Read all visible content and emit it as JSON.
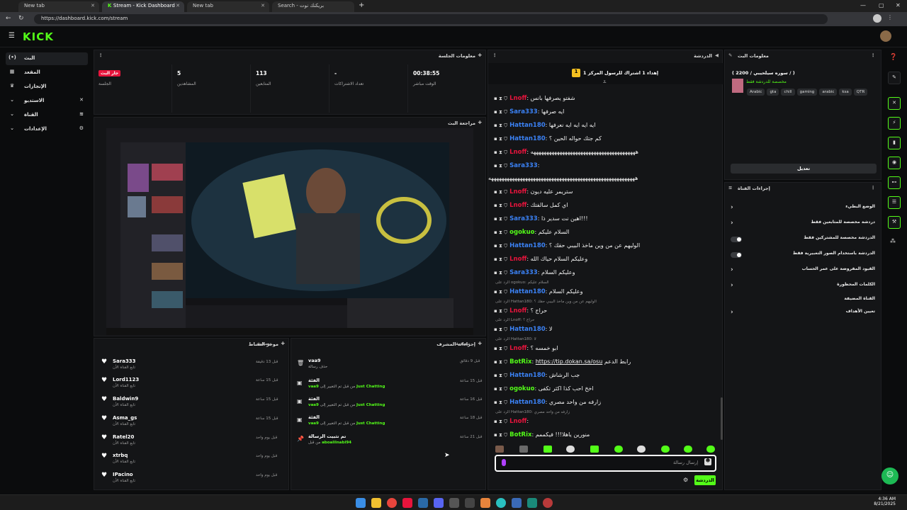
{
  "browser": {
    "tabs": [
      {
        "label": "New tab",
        "active": false
      },
      {
        "label": "Stream - Kick Dashboard",
        "active": true
      },
      {
        "label": "New tab",
        "active": false
      },
      {
        "label": "بريكنك نوت - Search",
        "active": false
      }
    ],
    "url": "https://dashboard.kick.com/stream"
  },
  "app": {
    "logo": "KICK"
  },
  "sidebar": {
    "items": [
      {
        "label": "البث",
        "icon": "(•)",
        "active": true
      },
      {
        "label": "المقعد",
        "icon": "▦",
        "active": false
      },
      {
        "label": "الإنجازات",
        "icon": "🏆",
        "active": false
      },
      {
        "label": "الاستديو",
        "icon": "✕",
        "active": false
      },
      {
        "label": "القناة",
        "icon": "≋",
        "active": false
      },
      {
        "label": "الإعدادات",
        "icon": "⚙",
        "active": false
      }
    ]
  },
  "session": {
    "title": "معلومات الجلسة",
    "live_badge": "جار البث",
    "stats": [
      {
        "value": "",
        "label": "الجلسة"
      },
      {
        "value": "5",
        "label": "المشاهدين"
      },
      {
        "value": "113",
        "label": "المتابعين"
      },
      {
        "value": "-",
        "label": "تعداد الاشتراكات"
      },
      {
        "value": "00:38:55",
        "label": "الوقت مباشر"
      }
    ]
  },
  "preview": {
    "title": "مراجعة البث"
  },
  "activity": {
    "title": "موجز النشاط",
    "filter": "تصفية",
    "rows": [
      {
        "name": "Sara333",
        "sub": "تابع القناة الأن",
        "time": "قبل 13 دقيقة"
      },
      {
        "name": "Lord1123",
        "sub": "تابع القناة الأن",
        "time": "قبل 15 ساعة"
      },
      {
        "name": "Baldwin9",
        "sub": "تابع القناة الأن",
        "time": "قبل 15 ساعة"
      },
      {
        "name": "Asma_gs",
        "sub": "تابع القناة الأن",
        "time": "قبل 15 ساعة"
      },
      {
        "name": "Ratel20",
        "sub": "تابع القناة الأن",
        "time": "قبل يوم واحد"
      },
      {
        "name": "xtrbq",
        "sub": "تابع القناة الأن",
        "time": "قبل يوم واحد"
      },
      {
        "name": "IPacino",
        "sub": "تابع القناة الأن",
        "time": "قبل يوم واحد"
      }
    ]
  },
  "modactions": {
    "title": "إجراءات المشرف",
    "filter": "تصفية",
    "rows": [
      {
        "icon": "🗑",
        "name": "vaa9",
        "sub_pre": "",
        "sub_green": "",
        "sub_post": "حذف رسالة",
        "time": "قبل 9 دقائق"
      },
      {
        "icon": "▣",
        "name": "الفئة",
        "sub_pre": "vaa9 ",
        "sub_green": "Just Chatting",
        "sub_post": " من قبل  تم التغيير إلى",
        "time": "قبل 15 ساعة"
      },
      {
        "icon": "▣",
        "name": "الفئة",
        "sub_pre": "vaa9 ",
        "sub_green": "Just Chatting",
        "sub_post": " من قبل  تم التغيير إلى",
        "time": "قبل 16 ساعة"
      },
      {
        "icon": "▣",
        "name": "الفئة",
        "sub_pre": "vaa9 ",
        "sub_green": "Just Chatting",
        "sub_post": " من قبل  تم التغيير إلى",
        "time": "قبل 18 ساعة"
      },
      {
        "icon": "📌",
        "name": "تم تثبيت الرسالة",
        "sub_pre": "",
        "sub_green": "aboalilnabi94",
        "sub_post": " من قبل",
        "time": "قبل 21 ساعة"
      }
    ]
  },
  "chat": {
    "title": "الدردشة",
    "pinned": "إهداء 1 اشتراك للرسول المركز 1",
    "pinned_rank": "1",
    "messages": [
      {
        "user": "Lnoff",
        "color": "#e8143c",
        "text": "شفتو يصرفها بانس"
      },
      {
        "user": "Sara333",
        "color": "#3b82f6",
        "text": "ايه صرفها"
      },
      {
        "user": "Hattan180",
        "color": "#3b82f6",
        "text": "ايه ايه ايه ايه نعرفها"
      },
      {
        "user": "Hattan180",
        "color": "#3b82f6",
        "text": "كم جتك حواله الحين ؟"
      },
      {
        "user": "Lnoff",
        "color": "#e8143c",
        "text": "ههههههههههههههههههههههههههههههههههههههههه"
      },
      {
        "user": "Sara333",
        "color": "#3b82f6",
        "text": ""
      },
      {
        "user": "",
        "color": "#fff",
        "text": "ههههههههههههههههههههههههههههههههههههههههههههههههههههههههه"
      },
      {
        "user": "Lnoff",
        "color": "#e8143c",
        "text": "ستريمر عليه ديون"
      },
      {
        "user": "Lnoff",
        "color": "#e8143c",
        "text": "اي كمل سالفتك"
      },
      {
        "user": "Sara333",
        "color": "#3b82f6",
        "text": "اهين نت سدير ذا!!!"
      },
      {
        "user": "ogokuo",
        "color": "#53fc18",
        "text": "السلام عليكم"
      },
      {
        "user": "Hattan180",
        "color": "#3b82f6",
        "text": "الوليهم عن من وين ماخذ البيبي حقك ؟"
      },
      {
        "user": "Lnoff",
        "color": "#e8143c",
        "text": "وعليكم السلام حياك الله"
      },
      {
        "user": "Sara333",
        "color": "#3b82f6",
        "text": "وعليكم السلام"
      },
      {
        "reply": "الرد على ogokuo: السلام عليكم"
      },
      {
        "user": "Hattan180",
        "color": "#3b82f6",
        "text": "وعليكم السلام"
      },
      {
        "reply": "الرد على Hattan180: الوليهم عن من وين ماخذ البيبي حقك ؟"
      },
      {
        "user": "Lnoff",
        "color": "#e8143c",
        "text": "حراج ؟"
      },
      {
        "reply": "الرد على Lnoff: حراج ؟"
      },
      {
        "user": "Hattan180",
        "color": "#3b82f6",
        "text": "لا"
      },
      {
        "reply": "الرد على Hattan180: لا"
      },
      {
        "user": "Lnoff",
        "color": "#e8143c",
        "text": "ابو خمسه ؟"
      },
      {
        "user": "BotRix",
        "color": "#53fc18",
        "text": "رابط الدعم",
        "link": "https://tip.dokan.sa/osu"
      },
      {
        "user": "Hattan180",
        "color": "#3b82f6",
        "text": "جب الرشاش"
      },
      {
        "user": "ogokuo",
        "color": "#53fc18",
        "text": "اخخ احب كذا اكثر تكفى"
      },
      {
        "user": "Hattan180",
        "color": "#3b82f6",
        "text": "زارفه من واحد مصري"
      },
      {
        "reply": "الرد على Hattan180: زارفه من واحد مصري"
      },
      {
        "user": "Lnoff",
        "color": "#e8143c",
        "text": ""
      },
      {
        "user": "BotRix",
        "color": "#53fc18",
        "text": "منورين ياهلا!!! فيكممم"
      }
    ],
    "input_placeholder": "إرسال رسالة",
    "send_label": "الدردشة"
  },
  "stream_info": {
    "title": "معلومات البث",
    "stream_title": "( سوره سيلحيبي / 2200 / )",
    "category": "مخصصة للدردشة فقط",
    "tags": [
      "Arabic",
      "gta",
      "chill",
      "gaming",
      "arabic",
      "ksa",
      "QTR"
    ],
    "edit_label": "تعديل"
  },
  "channel_actions": {
    "title": "إجراءات القناة",
    "rows": [
      {
        "label": "الوضع البطيء",
        "control": "arrow"
      },
      {
        "label": "دردشة مخصصة للمتابعين فقط",
        "control": "arrow"
      },
      {
        "label": "الدردشة مخصصة للمشتركين فقط",
        "control": "toggle"
      },
      {
        "label": "الدردشة باستخدام الصور التعبيرية فقط",
        "control": "toggle"
      },
      {
        "label": "القيود المفروضة على عمر الحساب",
        "control": "arrow"
      },
      {
        "label": "الكلمات المحظورة",
        "control": "arrow"
      },
      {
        "label": "القناة المضيفة",
        "control": "none"
      },
      {
        "label": "تعيين الأهداف",
        "control": "arrow"
      }
    ]
  },
  "taskbar": {
    "time": "4:36 AM",
    "date": "8/21/2025"
  }
}
